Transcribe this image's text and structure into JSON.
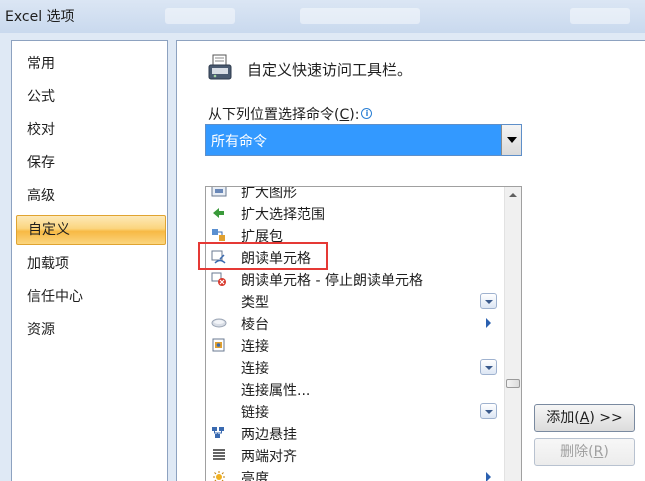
{
  "window": {
    "title": "Excel 选项"
  },
  "nav": {
    "items": [
      {
        "label": "常用"
      },
      {
        "label": "公式"
      },
      {
        "label": "校对"
      },
      {
        "label": "保存"
      },
      {
        "label": "高级"
      },
      {
        "label": "自定义",
        "selected": true
      },
      {
        "label": "加载项"
      },
      {
        "label": "信任中心"
      },
      {
        "label": "资源"
      }
    ]
  },
  "panel": {
    "title": "自定义快速访问工具栏。",
    "choose_label": "从下列位置选择命令(C):",
    "choose_label_prefix": "从下列位置选择命令(",
    "choose_label_key": "C",
    "choose_label_suffix": "):",
    "select_value": "所有命令"
  },
  "commands": [
    {
      "label": "扩大图形",
      "icon": "enlarge-shape-icon",
      "extra": "none"
    },
    {
      "label": "扩大选择范围",
      "icon": "green-arrow-icon",
      "extra": "none"
    },
    {
      "label": "扩展包",
      "icon": "expansion-pack-icon",
      "extra": "none"
    },
    {
      "label": "朗读单元格",
      "icon": "speak-cells-icon",
      "extra": "none",
      "highlighted": true
    },
    {
      "label": "朗读单元格 - 停止朗读单元格",
      "icon": "stop-speaking-icon",
      "extra": "none"
    },
    {
      "label": "类型",
      "icon": "",
      "extra": "dropdown"
    },
    {
      "label": "棱台",
      "icon": "bevel-icon",
      "extra": "submenu"
    },
    {
      "label": "连接",
      "icon": "connection-icon",
      "extra": "none"
    },
    {
      "label": "连接",
      "icon": "",
      "extra": "dropdown"
    },
    {
      "label": "连接属性...",
      "icon": "",
      "extra": "none"
    },
    {
      "label": "链接",
      "icon": "",
      "extra": "dropdown"
    },
    {
      "label": "两边悬挂",
      "icon": "hanging-icon",
      "extra": "none"
    },
    {
      "label": "两端对齐",
      "icon": "justify-icon",
      "extra": "none"
    },
    {
      "label": "亮度",
      "icon": "brightness-icon",
      "extra": "submenu"
    }
  ],
  "buttons": {
    "add_prefix": "添加(",
    "add_key": "A",
    "add_suffix": ") >>",
    "remove_prefix": "删除(",
    "remove_key": "R",
    "remove_suffix": ")"
  },
  "colors": {
    "selection_blue": "#3399ff",
    "nav_selected": "#fbd57e",
    "highlight_box": "#e53935"
  }
}
